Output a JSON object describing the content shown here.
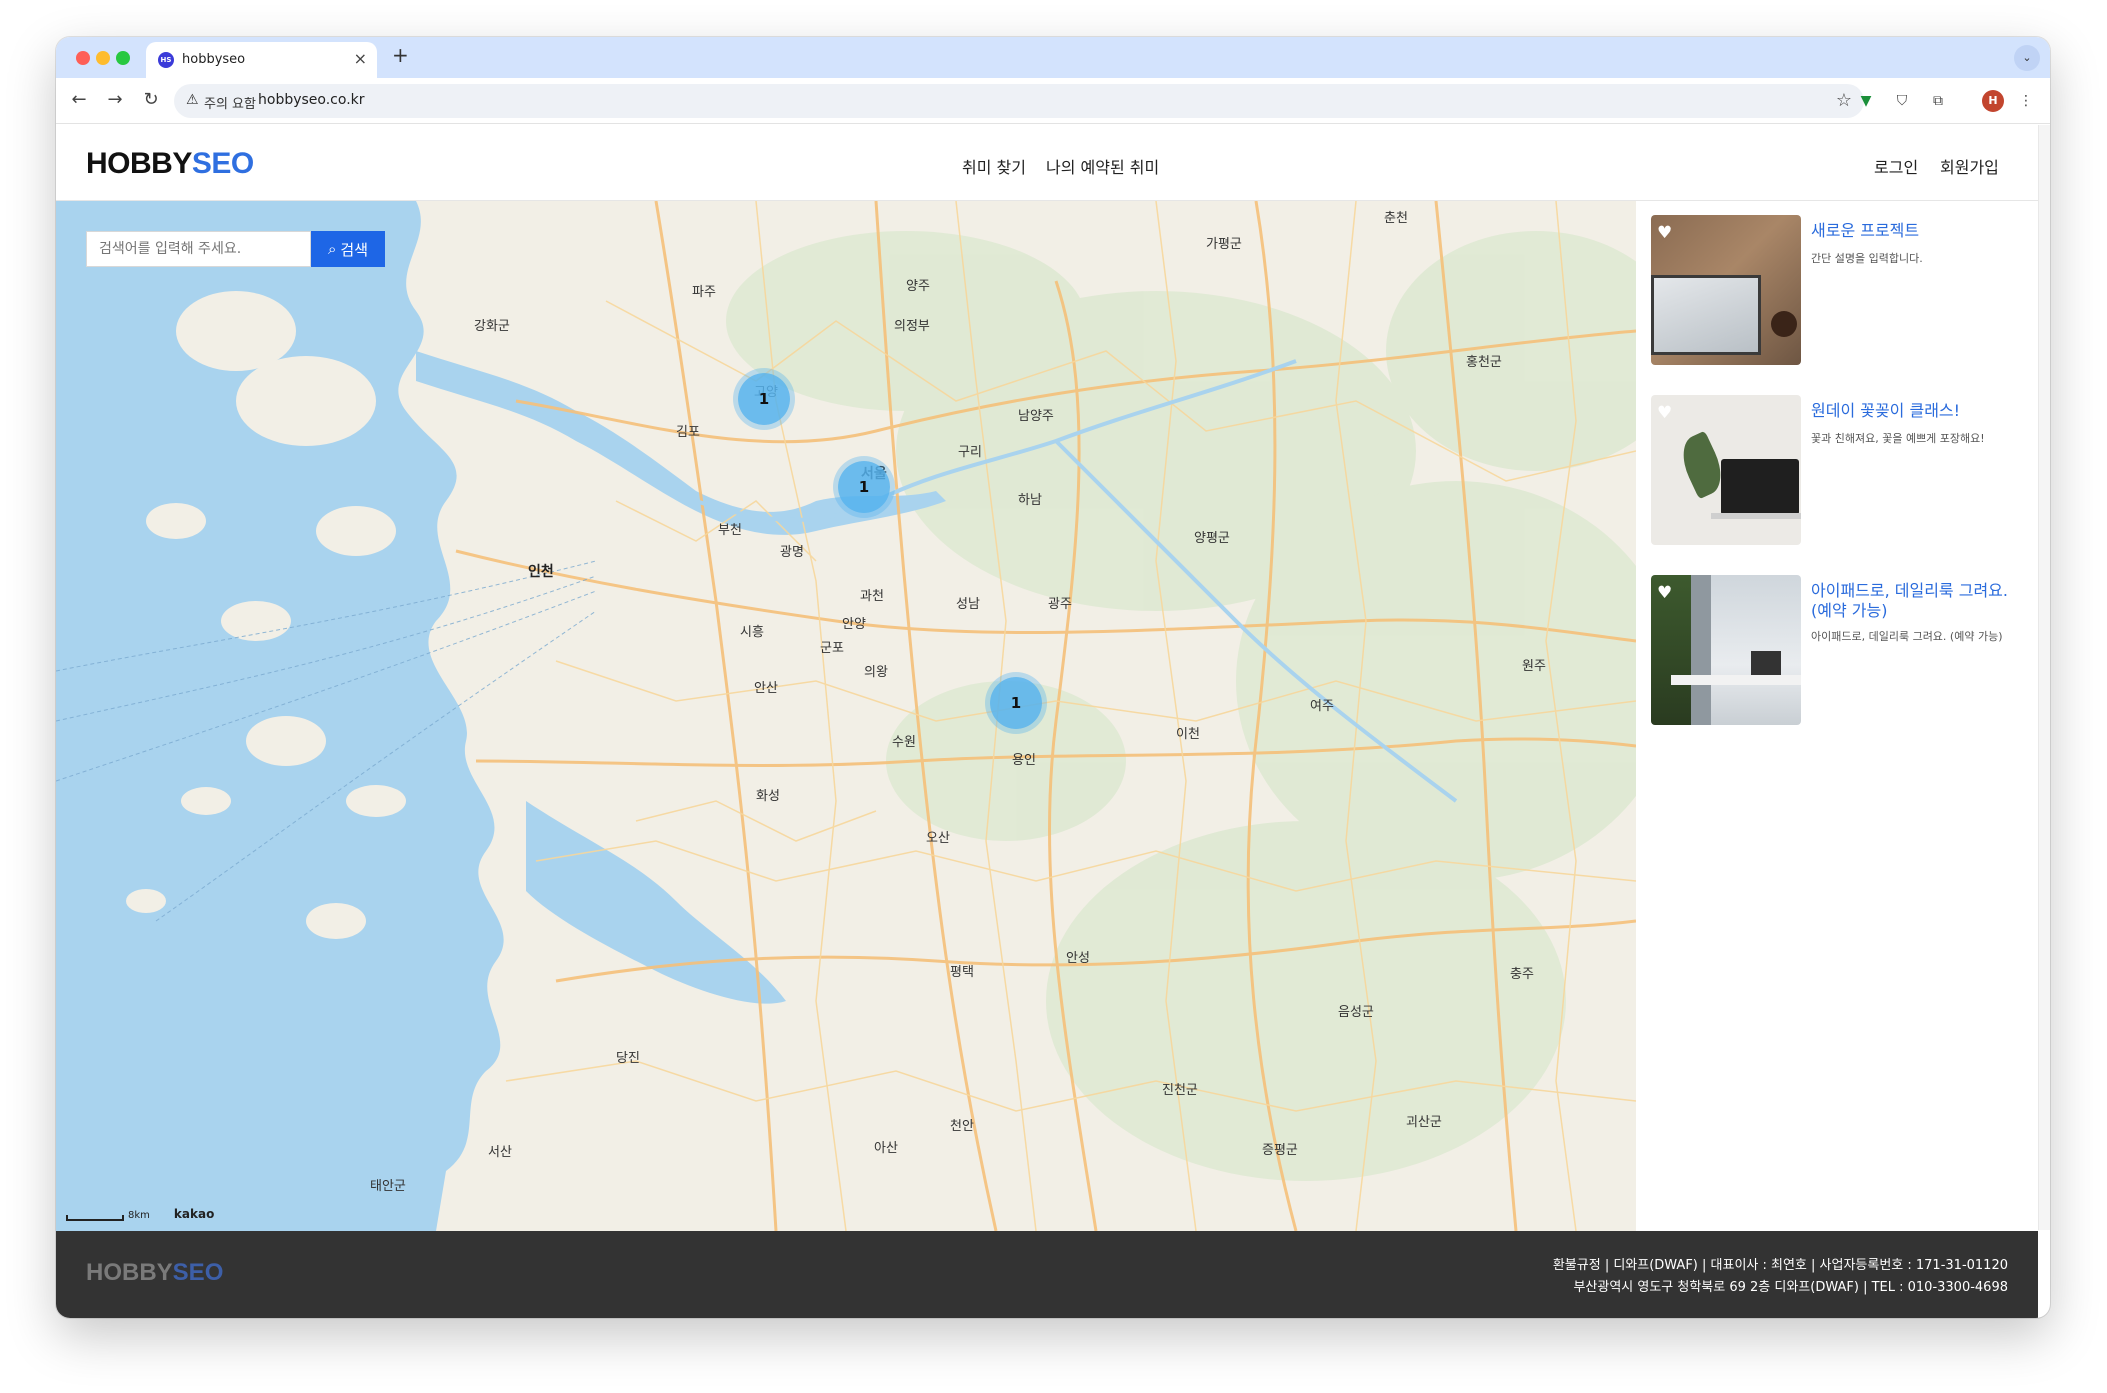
{
  "browser": {
    "tab_title": "hobbyseo",
    "tab_favicon": "HS",
    "security_label": "주의 요함",
    "url": "hobbyseo.co.kr",
    "profile_initial": "H"
  },
  "site": {
    "logo_part1": "HOBBY",
    "logo_part2": "SEO",
    "nav": [
      "취미 찾기",
      "나의 예약된 취미"
    ],
    "auth": [
      "로그인",
      "회원가입"
    ]
  },
  "search": {
    "placeholder": "검색어를 입력해 주세요.",
    "button_label": "검색"
  },
  "map": {
    "clusters": [
      "1",
      "1",
      "1"
    ],
    "scale_label": "8km",
    "attribution": "kakao",
    "labels": [
      "파주",
      "양주",
      "의정부",
      "김포",
      "고양",
      "남양주",
      "구리",
      "서울",
      "부천",
      "인천",
      "광명",
      "하남",
      "과천",
      "성남",
      "광주",
      "시흥",
      "안양",
      "군포",
      "의왕",
      "안산",
      "수원",
      "용인",
      "이천",
      "화성",
      "오산",
      "평택",
      "안성",
      "당진",
      "천안",
      "아산",
      "서산",
      "춘천",
      "홍천군",
      "양평군",
      "여주",
      "원주",
      "충주",
      "음성군",
      "진천군",
      "괴산군",
      "증평군",
      "강화군",
      "태안군",
      "가평군"
    ]
  },
  "listings": [
    {
      "title": "새로운 프로젝트",
      "description": "간단 설명을 입력합니다."
    },
    {
      "title": "원데이 꽃꽂이 클래스!",
      "description": "꽃과 친해져요, 꽃을 예쁘게 포장해요!"
    },
    {
      "title": "아이패드로, 데일리룩 그려요.(예약 가능)",
      "description": "아이패드로, 데일리룩 그려요. (예약 가능)"
    }
  ],
  "footer": {
    "logo_part1": "HOBBY",
    "logo_part2": "SEO",
    "line1": "환불규정 | 디와프(DWAF) | 대표이사 : 최연호 | 사업자등록번호 : 171-31-01120",
    "line2": "부산광역시 영도구 청학북로 69 2층 디와프(DWAF) | TEL : 010-3300-4698"
  },
  "colors": {
    "accent": "#1e66e6",
    "logo_blue": "#2f6fe0",
    "footer_bg": "#333333",
    "cluster": "#54b2ed"
  }
}
